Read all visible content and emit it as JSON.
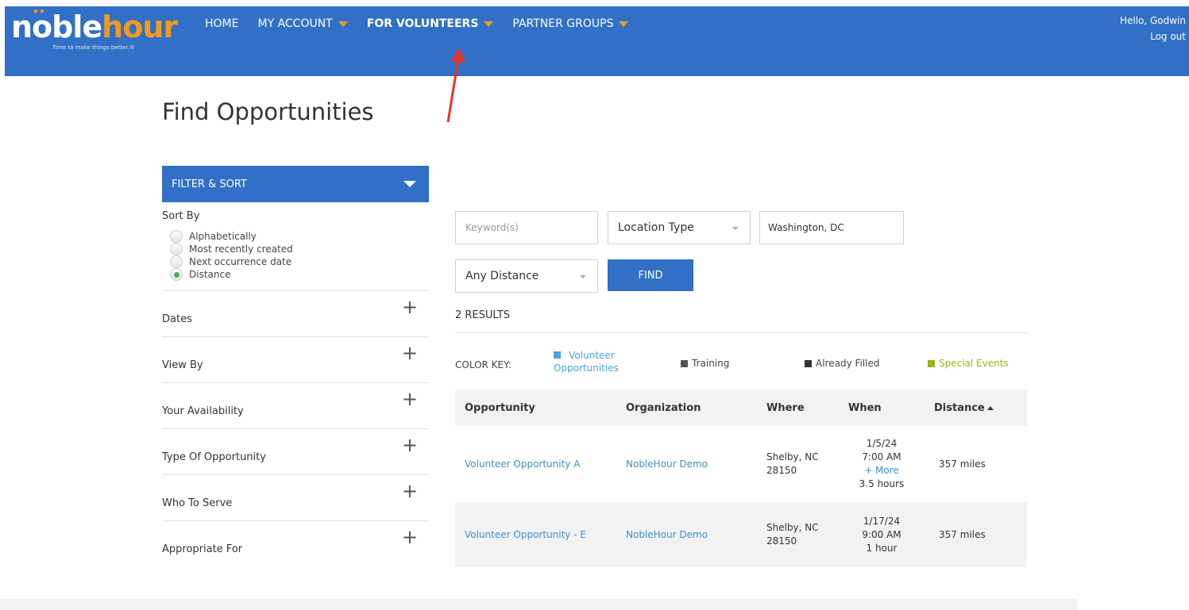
{
  "brand": {
    "noble": "noble",
    "hour": "hour",
    "tagline": "Time to make things better.®"
  },
  "nav": {
    "items": [
      {
        "label": "HOME",
        "has_caret": false,
        "bold": false
      },
      {
        "label": "MY ACCOUNT",
        "has_caret": true,
        "bold": false
      },
      {
        "label": "FOR VOLUNTEERS",
        "has_caret": true,
        "bold": true
      },
      {
        "label": "PARTNER GROUPS",
        "has_caret": true,
        "bold": false
      }
    ]
  },
  "user": {
    "greeting": "Hello, Godwin",
    "logout": "Log out"
  },
  "page": {
    "title": "Find Opportunities"
  },
  "filter": {
    "header": "FILTER & SORT",
    "sort_by_title": "Sort By",
    "sort_options": [
      {
        "label": "Alphabetically",
        "selected": false
      },
      {
        "label": "Most recently created",
        "selected": false
      },
      {
        "label": "Next occurrence date",
        "selected": false
      },
      {
        "label": "Distance",
        "selected": true
      }
    ],
    "facets": [
      {
        "label": "Dates"
      },
      {
        "label": "View By"
      },
      {
        "label": "Your Availability"
      },
      {
        "label": "Type Of Opportunity"
      },
      {
        "label": "Who To Serve"
      },
      {
        "label": "Appropriate For"
      }
    ],
    "plus_symbol": "+"
  },
  "search": {
    "keyword_placeholder": "Keyword(s)",
    "location_type": "Location Type",
    "location_value": "Washington, DC",
    "distance": "Any Distance",
    "find_label": "FIND"
  },
  "results": {
    "count_label": "2 RESULTS",
    "color_key_label": "COLOR KEY:",
    "color_key": [
      {
        "label_line1": "Volunteer",
        "label_line2": "Opportunities",
        "color": "#4aa3df",
        "text_color": "#4aa3df"
      },
      {
        "label": "Training",
        "color": "#555555",
        "text_color": "#444444"
      },
      {
        "label": "Already Filled",
        "color": "#333333",
        "text_color": "#444444"
      },
      {
        "label": "Special Events",
        "color": "#9bb21a",
        "text_color": "#9bb21a"
      }
    ],
    "columns": [
      "Opportunity",
      "Organization",
      "Where",
      "When",
      "Distance"
    ],
    "rows": [
      {
        "opportunity": "Volunteer Opportunity A",
        "organization": "NobleHour Demo",
        "where_line1": "Shelby, NC",
        "where_line2": "28150",
        "when_date": "1/5/24",
        "when_time": "7:00 AM",
        "when_more": "+ More",
        "when_duration": "3.5 hours",
        "distance": "357 miles"
      },
      {
        "opportunity": "Volunteer Opportunity - E",
        "organization": "NobleHour Demo",
        "where_line1": "Shelby, NC",
        "where_line2": "28150",
        "when_date": "1/17/24",
        "when_time": "9:00 AM",
        "when_more": "",
        "when_duration": "1 hour",
        "distance": "357 miles"
      }
    ]
  },
  "colors": {
    "header_blue": "#3170c6",
    "accent_orange": "#f39a1e",
    "link_blue": "#3a8fd1",
    "annotation_red": "#e53427"
  }
}
